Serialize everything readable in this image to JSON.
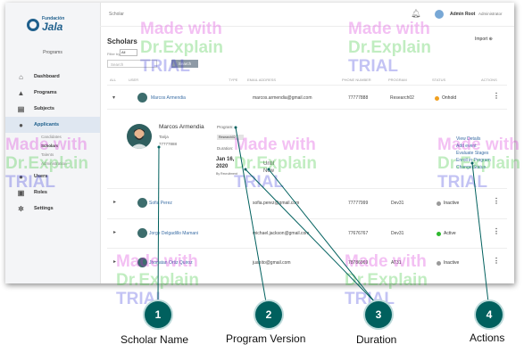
{
  "sidebar": {
    "logo_top": "Fundación",
    "logo_bottom": "Jala",
    "subtitle": "Programs",
    "items": [
      {
        "label": "Dashboard",
        "icon": "home-icon"
      },
      {
        "label": "Programs",
        "icon": "graduation-cap-icon"
      },
      {
        "label": "Subjects",
        "icon": "book-icon"
      },
      {
        "label": "Applicants",
        "icon": "users-icon"
      }
    ],
    "subitems": [
      "Candidates",
      "Scholars",
      "Talents",
      "Administration"
    ],
    "bottom_items": [
      {
        "label": "Users",
        "icon": "user-icon"
      },
      {
        "label": "Roles",
        "icon": "id-card-icon"
      },
      {
        "label": "Settings",
        "icon": "gear-icon"
      }
    ]
  },
  "topbar": {
    "breadcrumb": "Scholar",
    "user_name": "Admin Root",
    "user_role": "Administrator"
  },
  "page": {
    "title": "Scholars",
    "import_label": "Import",
    "filter_label": "Filter by",
    "filter_value": "All",
    "search_placeholder": "Search",
    "search_button": "Search"
  },
  "table": {
    "headers": [
      "ALL",
      "USER",
      "TYPE",
      "EMAIL ADDRESS",
      "PHONE NUMBER",
      "PROGRAM",
      "STATUS",
      "ACTIONS"
    ],
    "rows": [
      {
        "name": "Marcos Armendia",
        "email": "marcos.armendia@gmail.com",
        "phone": "77777888",
        "program": "Research02",
        "status": "Onhold",
        "status_color": "#f0a020"
      },
      {
        "name": "Sofia Perez",
        "email": "sofia.perez@gmail.com",
        "phone": "77777999",
        "program": "Dev31",
        "status": "Inactive",
        "status_color": "#999999"
      },
      {
        "name": "Jorge Delgadillo Mamani",
        "email": "michael.jackson@gmail.com",
        "phone": "77676767",
        "program": "Dev31",
        "status": "Active",
        "status_color": "#2eb82e"
      },
      {
        "name": "Jhonatan Ortiz Quiroz",
        "email": "juanito@gmail.com",
        "phone": "78786969",
        "program": "AT31",
        "status": "Inactive",
        "status_color": "#999999"
      }
    ]
  },
  "detail": {
    "name": "Marcos Armendia",
    "city": "Tarija",
    "phone": "77777888",
    "program_label": "Program:",
    "program_chip": "Research02",
    "duration_label": "Duration:",
    "start_date": "Jan 16, 2020",
    "start_note": "By Recruitment",
    "until_label": "Until Now",
    "actions": [
      "View Details",
      "Add event",
      "Evaluate Stages",
      "Enroll in Program",
      "Change Status"
    ]
  },
  "watermark": {
    "line1": "Made with",
    "line2": "Dr.Explain",
    "line3": "TRIAL"
  },
  "callouts": [
    {
      "number": "1",
      "label": "Scholar Name"
    },
    {
      "number": "2",
      "label": "Program Version"
    },
    {
      "number": "3",
      "label": "Duration"
    },
    {
      "number": "4",
      "label": "Actions"
    }
  ],
  "colors": {
    "brand": "#1e5f8c",
    "callout": "#00605e",
    "link": "#3b6ea5"
  }
}
